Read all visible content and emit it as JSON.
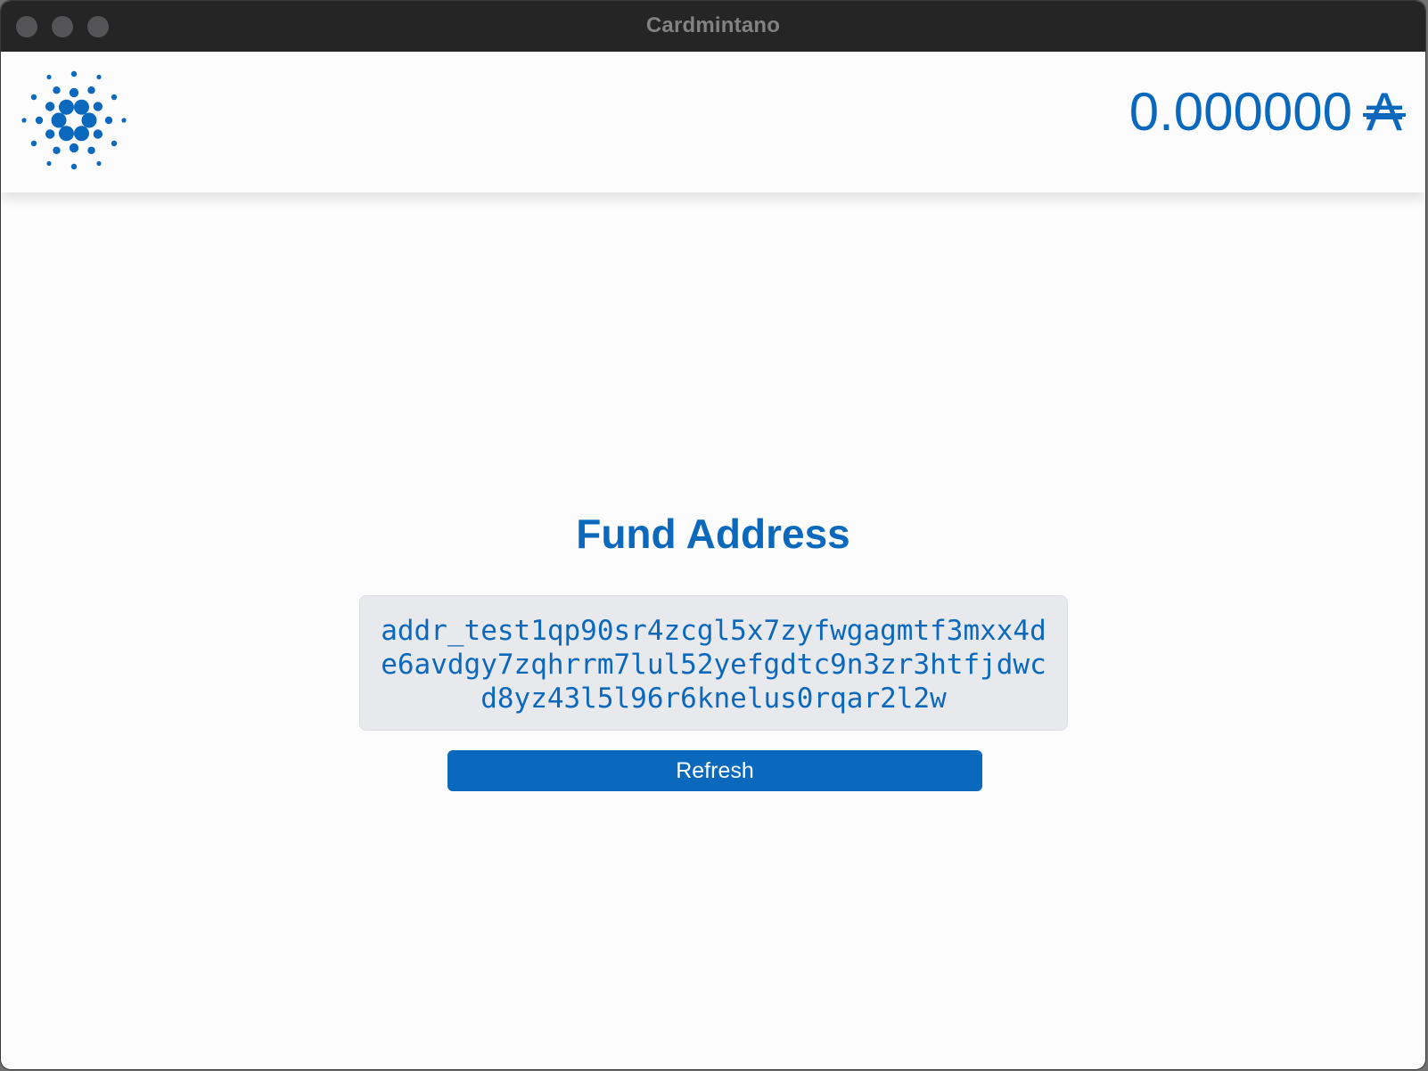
{
  "window": {
    "title": "Cardmintano"
  },
  "header": {
    "logo_icon": "cardano-logo-icon",
    "balance_value": "0.000000",
    "balance_unit": "₳"
  },
  "main": {
    "title": "Fund Address",
    "address": "addr_test1qp90sr4zcgl5x7zyfwgagmtf3mxx4de6avdgy7zqhrrm7lul52yefgdtc9n3zr3htfjdwcd8yz43l5l96r6knelus0rqar2l2w",
    "refresh_label": "Refresh"
  },
  "colors": {
    "accent": "#0a68bd",
    "titlebar": "#252525",
    "background": "#fcfcfd",
    "address_box": "#e8e9ec"
  }
}
